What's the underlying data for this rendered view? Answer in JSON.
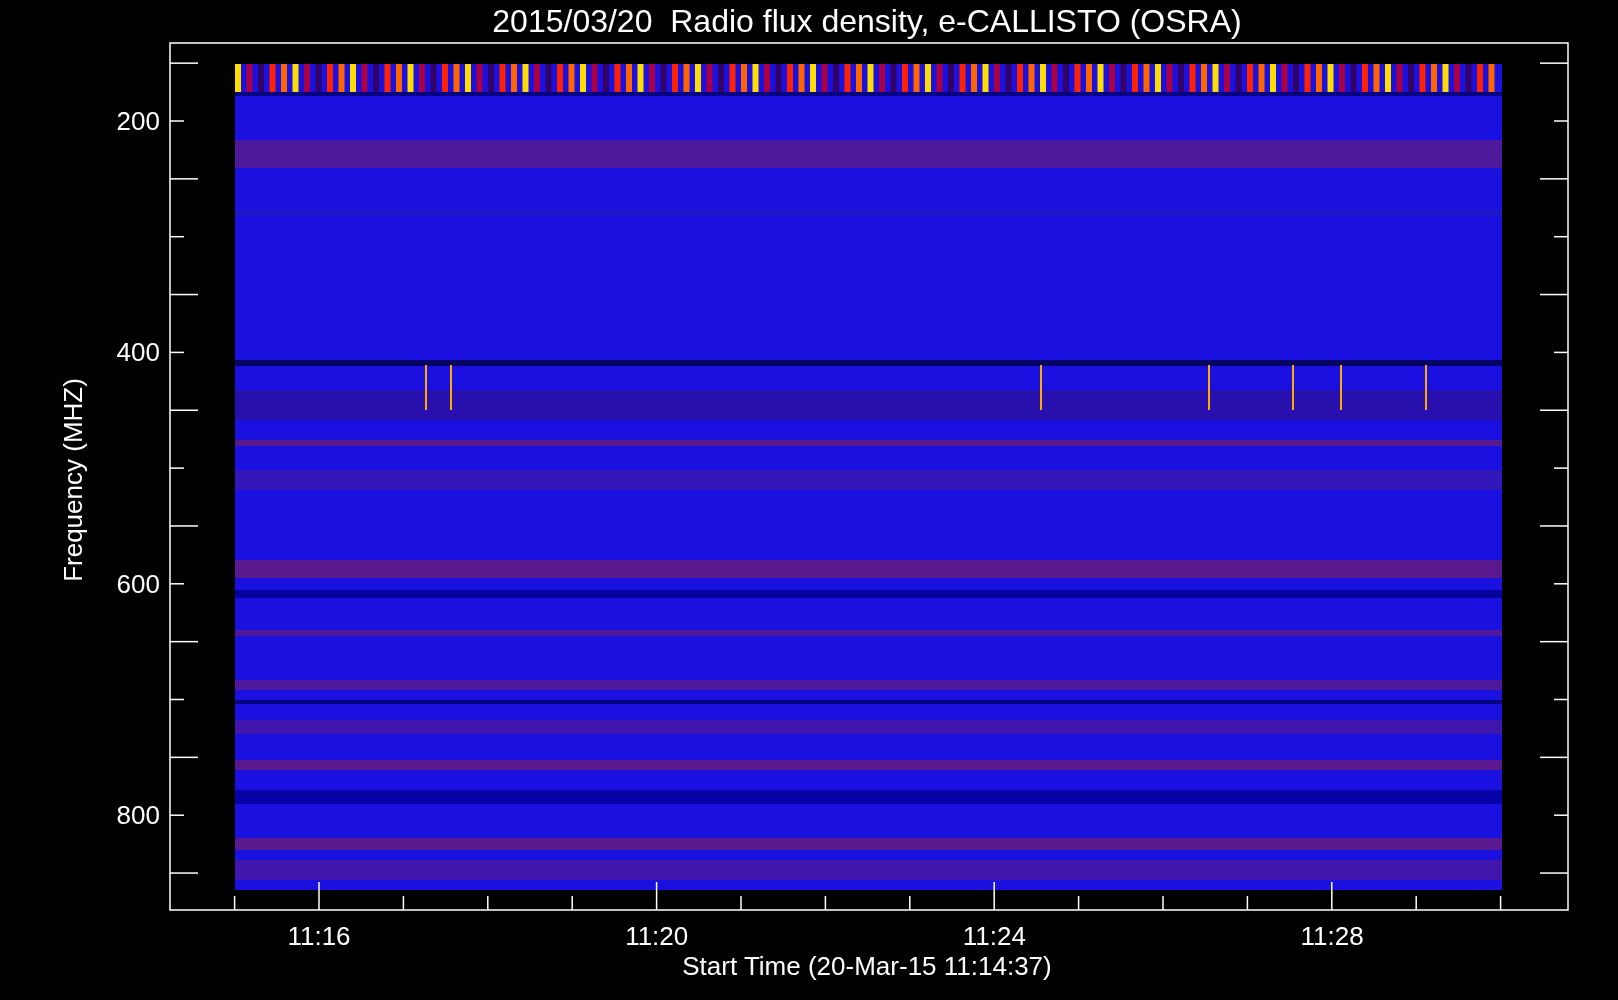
{
  "title": "2015/03/20  Radio flux density, e-CALLISTO (OSRA)",
  "y_axis": {
    "label": "Frequency (MHZ)",
    "ticks": [
      "200",
      "400",
      "600",
      "800"
    ]
  },
  "x_axis": {
    "label": "Start Time (20-Mar-15 11:14:37)",
    "ticks": [
      "11:16",
      "11:20",
      "11:24",
      "11:28"
    ]
  }
}
